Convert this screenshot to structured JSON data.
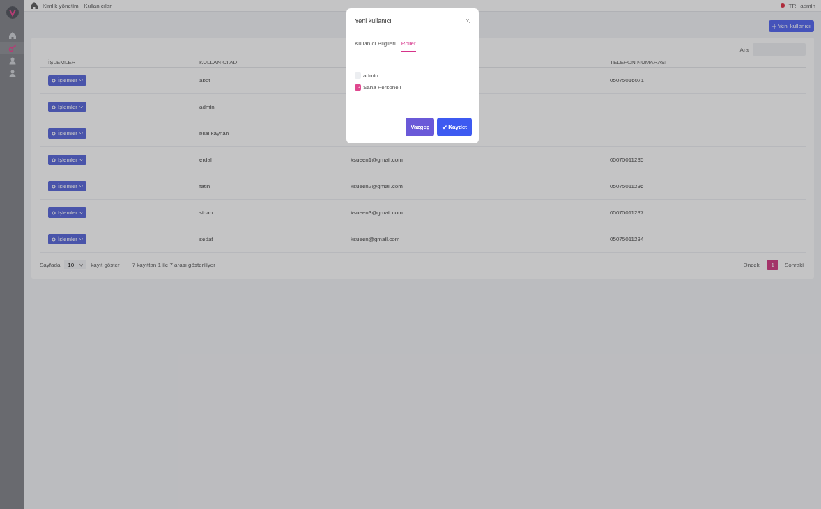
{
  "breadcrumb": [
    "Kimlik yönetimi",
    "Kullanıcılar"
  ],
  "user_menu": {
    "language": "TR",
    "user": "admin"
  },
  "sidebar": {
    "items": [
      {
        "kind": "home",
        "selected": false
      },
      {
        "kind": "key",
        "selected": true
      },
      {
        "kind": "user",
        "selected": false
      },
      {
        "kind": "user",
        "selected": false
      }
    ]
  },
  "new_user_button": "Yeni kullanıcı",
  "search": {
    "label": "Ara"
  },
  "table": {
    "columns": [
      "İŞLEMLER",
      "KULLANICI ADI",
      "TELEFON NUMARASI"
    ],
    "rows": [
      {
        "action": "İşlemler",
        "username": "abot",
        "email": "",
        "phone": "05075016071"
      },
      {
        "action": "İşlemler",
        "username": "admin",
        "email": "",
        "phone": ""
      },
      {
        "action": "İşlemler",
        "username": "bilal.kaynan",
        "email": "",
        "phone": ""
      },
      {
        "action": "İşlemler",
        "username": "erdal",
        "email": "ksueen1@gmail.com",
        "phone": "05075011235"
      },
      {
        "action": "İşlemler",
        "username": "fatih",
        "email": "ksueen2@gmail.com",
        "phone": "05075011236"
      },
      {
        "action": "İşlemler",
        "username": "sinan",
        "email": "ksueen3@gmail.com",
        "phone": "05075011237"
      },
      {
        "action": "İşlemler",
        "username": "sedat",
        "email": "ksueen@gmail.com",
        "phone": "05075011234"
      }
    ]
  },
  "footer": {
    "page_size_label": "Sayfada",
    "page_size": "10",
    "page_size_suffix": "kayıt göster",
    "info": "7 kayıttan 1 ile 7 arası gösteriliyor"
  },
  "pagination": {
    "previous": "Önceki",
    "pages": [
      {
        "label": "1",
        "selected": true
      }
    ],
    "next": "Sonraki"
  },
  "modal": {
    "title": "Yeni kullanıcı",
    "tabs": [
      {
        "label": "Kullanıcı Bilgileri",
        "selected": false
      },
      {
        "label": "Roller",
        "selected": true
      }
    ],
    "roles": [
      {
        "label": "admin",
        "checked": false
      },
      {
        "label": "Saha Personeli",
        "checked": true
      }
    ],
    "cancel_button": "Vazgeç",
    "save_button": "Kaydet"
  }
}
